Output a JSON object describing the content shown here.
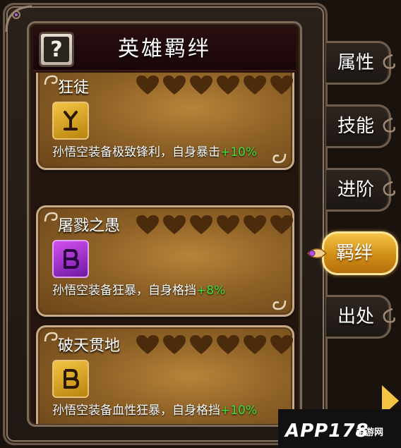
{
  "header": {
    "title": "英雄羁绊",
    "help_label": "?"
  },
  "bonds": [
    {
      "name": "狂徒",
      "rune_color": "gold",
      "rune_icon": "gold-rune-icon",
      "desc_main": "孙悟空装备极致锋利，自身暴击",
      "desc_bonus": "+10%",
      "hearts_filled": 0,
      "hearts_total": 6
    },
    {
      "name": "屠戮之愚",
      "rune_color": "purple",
      "rune_icon": "purple-rune-icon",
      "desc_main": "孙悟空装备狂暴，自身格挡",
      "desc_bonus": "+8%",
      "hearts_filled": 0,
      "hearts_total": 6
    },
    {
      "name": "破天贯地",
      "rune_color": "gold",
      "rune_icon": "gold-rune-icon",
      "desc_main": "孙悟空装备血性狂暴，自身格挡",
      "desc_bonus": "+10%",
      "hearts_filled": 0,
      "hearts_total": 6
    }
  ],
  "tabs": [
    {
      "label": "属性",
      "active": false
    },
    {
      "label": "技能",
      "active": false
    },
    {
      "label": "进阶",
      "active": false
    },
    {
      "label": "羁绊",
      "active": true
    },
    {
      "label": "出处",
      "active": false
    }
  ],
  "watermark": {
    "text": "APP178",
    "sub": "手游网"
  },
  "colors": {
    "bonus_green": "#3ee03a",
    "active_tab": "#e9a52a",
    "card_gold": "#8e6126"
  }
}
